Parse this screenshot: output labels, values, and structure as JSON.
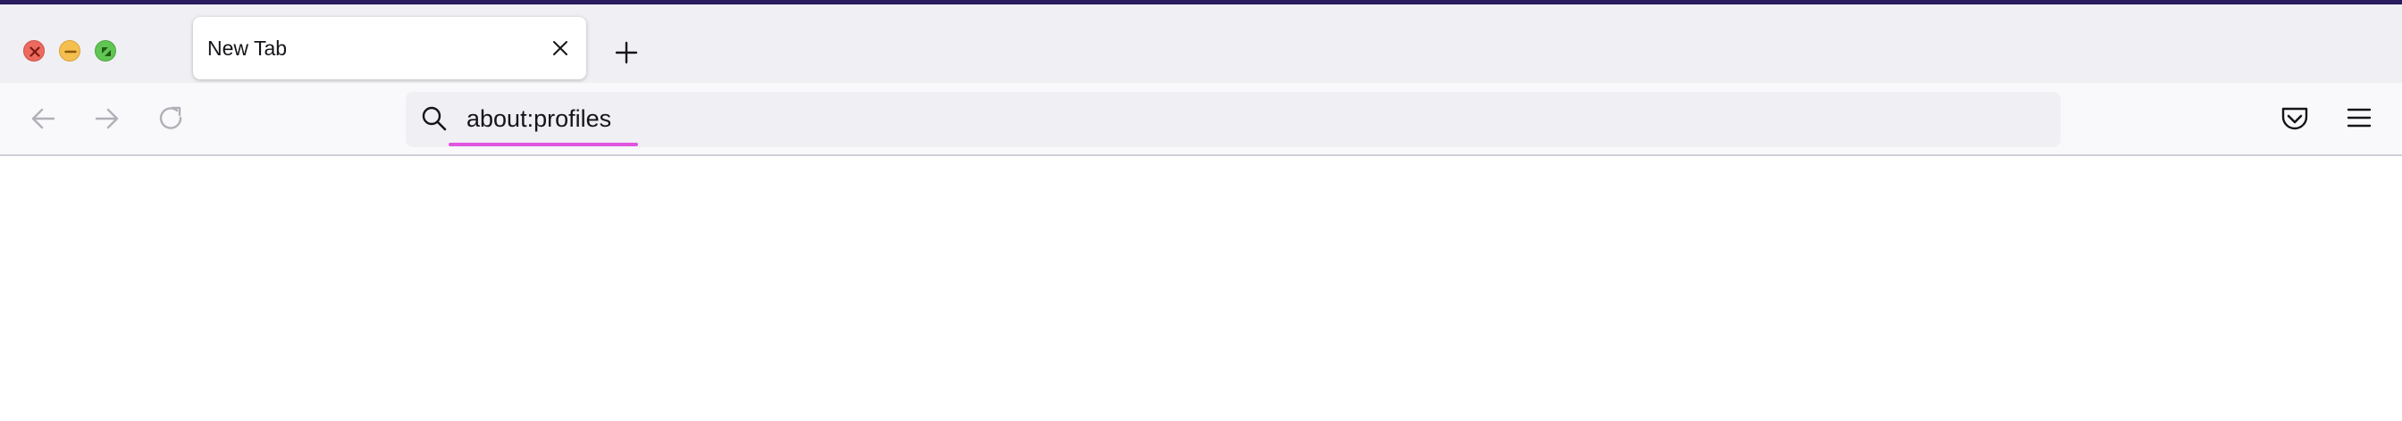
{
  "window": {
    "controls": {
      "close": "close-window",
      "minimize": "minimize-window",
      "maximize": "maximize-window"
    }
  },
  "tabs": [
    {
      "label": "New Tab",
      "active": true
    }
  ],
  "toolbar": {
    "back_icon": "arrow-left-icon",
    "forward_icon": "arrow-right-icon",
    "reload_icon": "reload-icon",
    "pocket_icon": "pocket-icon",
    "menu_icon": "hamburger-menu-icon"
  },
  "urlbar": {
    "value": "about:profiles",
    "search_icon": "search-icon"
  },
  "colors": {
    "tab_strip": "#f0eff4",
    "nav_bar": "#f9f9fb",
    "urlbar_bg": "#f0f0f4",
    "url_underline": "#e055e0",
    "close_red": "#ed6a5e",
    "minimize_yellow": "#f5bf4f",
    "maximize_green": "#61c554"
  }
}
